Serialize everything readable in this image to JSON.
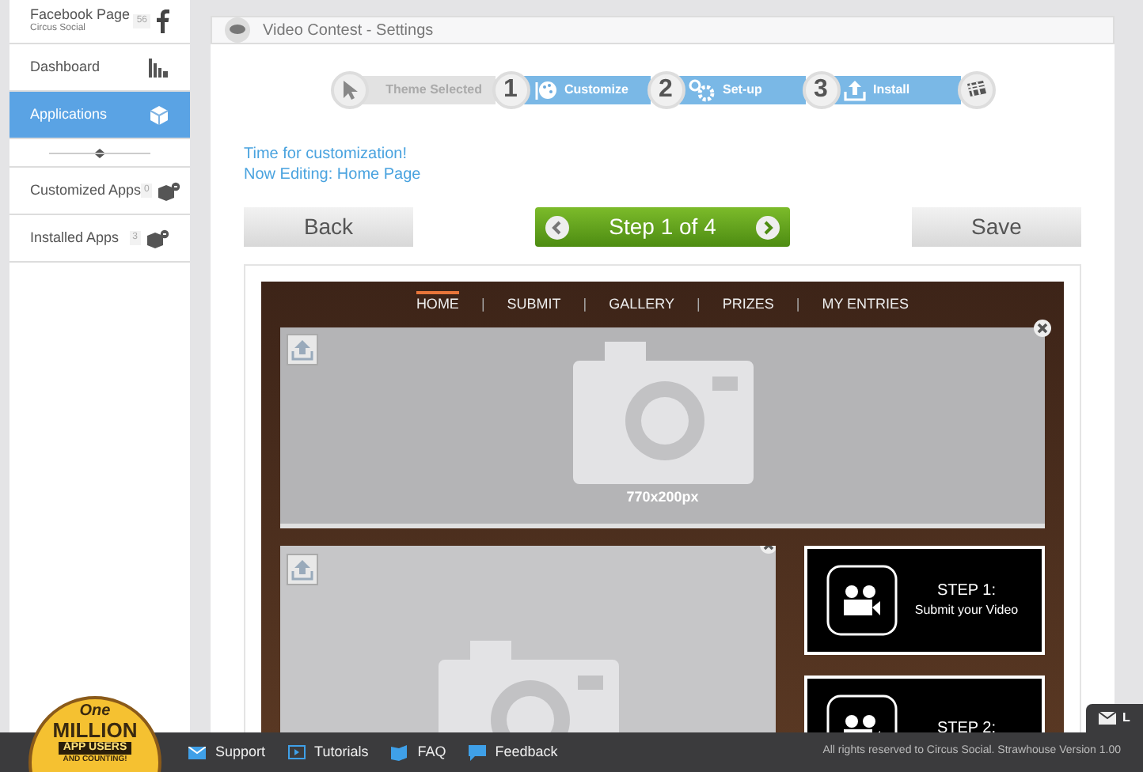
{
  "sidebar": {
    "items": [
      {
        "label": "Facebook Page",
        "sub": "Circus Social",
        "count": "56",
        "kind": "facebook",
        "selected": false
      },
      {
        "label": "Dashboard",
        "kind": "chart",
        "selected": false
      },
      {
        "label": "Applications",
        "kind": "box",
        "selected": true
      },
      {
        "kind": "handle"
      },
      {
        "label": "Customized Apps",
        "count": "0",
        "kind": "boxes",
        "selected": false
      },
      {
        "label": "Installed Apps",
        "count": "3",
        "kind": "boxes",
        "selected": false
      }
    ]
  },
  "panel": {
    "title": "Video Contest - Settings"
  },
  "steps": [
    {
      "label": "Theme Selected",
      "number": "1",
      "kind": "pointer",
      "active": false
    },
    {
      "label": "Customize",
      "number": "2",
      "kind": "palette",
      "active": true
    },
    {
      "label": "Set-up",
      "number": "3",
      "kind": "gears",
      "active": true
    },
    {
      "label": "Install",
      "kind": "upload",
      "active": true
    }
  ],
  "intro": [
    "Time for customization!",
    "Now Editing: Home Page"
  ],
  "buttons": {
    "back": "Back",
    "step": "Step 1 of 4",
    "save": "Save"
  },
  "preview": {
    "nav": [
      {
        "label": "HOME",
        "selected": true
      },
      {
        "label": "SUBMIT",
        "selected": false
      },
      {
        "label": "GALLERY",
        "selected": false
      },
      {
        "label": "PRIZES",
        "selected": false
      },
      {
        "label": "MY ENTRIES",
        "selected": false
      }
    ],
    "separator": "|",
    "banner_size": "770x200px",
    "cards": [
      {
        "title": "STEP 1:",
        "text": "Submit your Video"
      },
      {
        "title": "STEP 2:"
      }
    ]
  },
  "badge": {
    "top": "One",
    "main": "MILLION",
    "line1": "APP USERS",
    "line2": "AND COUNTING!"
  },
  "footer": {
    "links": [
      {
        "label": "Support",
        "kind": "mail"
      },
      {
        "label": "Tutorials",
        "kind": "play"
      },
      {
        "label": "FAQ",
        "kind": "book"
      },
      {
        "label": "Feedback",
        "kind": "chat"
      }
    ],
    "copyright": "All rights reserved to Circus Social. Strawhouse Version 1.00"
  },
  "chat_tab": {
    "label": "L"
  }
}
